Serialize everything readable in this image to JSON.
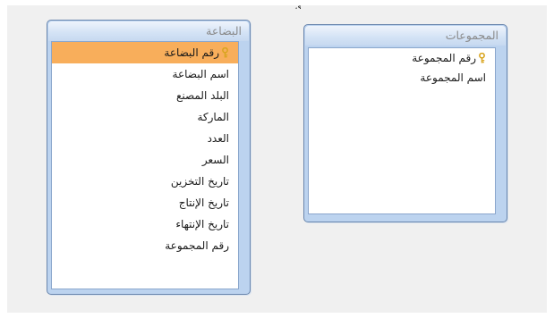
{
  "tables": [
    {
      "id": "products",
      "title": "البضاعة",
      "fields": [
        {
          "label": "رقم البضاعة",
          "primary_key": true,
          "selected": true
        },
        {
          "label": "اسم البضاعة",
          "primary_key": false,
          "selected": false
        },
        {
          "label": "البلد المصنع",
          "primary_key": false,
          "selected": false
        },
        {
          "label": "الماركة",
          "primary_key": false,
          "selected": false
        },
        {
          "label": "العدد",
          "primary_key": false,
          "selected": false
        },
        {
          "label": "السعر",
          "primary_key": false,
          "selected": false
        },
        {
          "label": "تاريخ التخزين",
          "primary_key": false,
          "selected": false
        },
        {
          "label": "تاريخ الإنتاج",
          "primary_key": false,
          "selected": false
        },
        {
          "label": "تاريخ الإنتهاء",
          "primary_key": false,
          "selected": false
        },
        {
          "label": "رقم المجموعة",
          "primary_key": false,
          "selected": false
        }
      ]
    },
    {
      "id": "groups",
      "title": "المجموعات",
      "fields": [
        {
          "label": "رقم المجموعة",
          "primary_key": true,
          "selected": false
        },
        {
          "label": "اسم المجموعة",
          "primary_key": false,
          "selected": false
        }
      ]
    }
  ],
  "icons": {
    "primary_key": "key-icon"
  },
  "colors": {
    "selected_row": "#f8ae5b",
    "window_frame": "#bcd3ef",
    "key_icon": "#d9a520"
  }
}
